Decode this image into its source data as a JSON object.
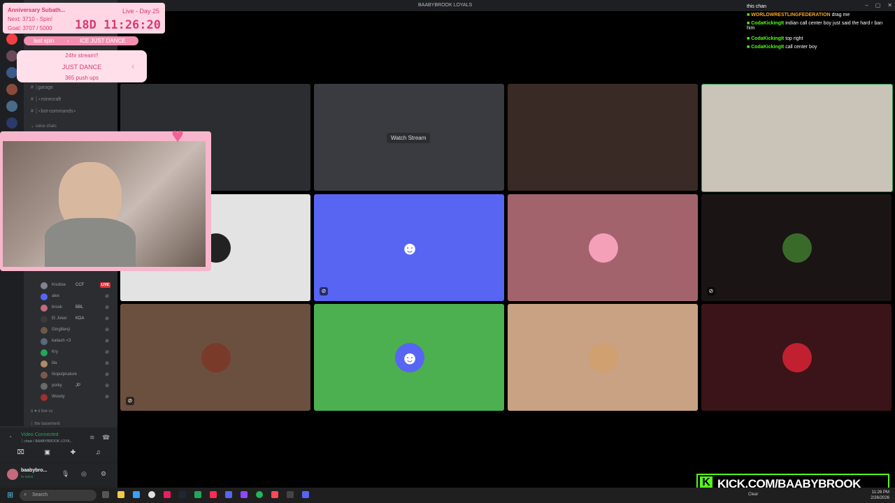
{
  "titlebar": {
    "title": "BAABYBROOK LOYALS",
    "controls": [
      "–",
      "▢",
      "✕"
    ]
  },
  "overlay": {
    "subathon_title": "Anniversary Subath...",
    "day_label": "Live - Day 25",
    "next_label": "Next: 3710 - Spin!",
    "goal_label": "Goal: 3707 / 5000",
    "timer": "18D 11:26:20",
    "last_spin_label": "last spin",
    "last_spin_value": "ICE JUST DANCE",
    "wheel_items": [
      "24hr stream!!",
      "JUST DANCE",
      "365 push ups"
    ]
  },
  "channels": [
    {
      "label": "# ┆garage"
    },
    {
      "label": "# ┆⋆minecraft"
    },
    {
      "label": "# ┆⋆bot-commands⋆"
    },
    {
      "label": "⌄ voice chats"
    }
  ],
  "members": [
    {
      "name": "Knotise",
      "tag": "CCF",
      "badge": "LIVE",
      "color": "#80848e"
    },
    {
      "name": "alex",
      "tag": "",
      "badge": "",
      "color": "#5865f2"
    },
    {
      "name": "brook",
      "tag": "BBL",
      "badge": "",
      "color": "#c46a7a"
    },
    {
      "name": "El Joker",
      "tag": "KDA",
      "badge": "",
      "color": "#3a3a3a"
    },
    {
      "name": "Gingillenji",
      "tag": "",
      "badge": "",
      "color": "#6b5a4a"
    },
    {
      "name": "kailash <3",
      "tag": "",
      "badge": "",
      "color": "#5a6a7a"
    },
    {
      "name": "Kry",
      "tag": "",
      "badge": "",
      "color": "#23a55a"
    },
    {
      "name": "lila",
      "tag": "",
      "badge": "",
      "color": "#b08a6a"
    },
    {
      "name": "Nopulpnature",
      "tag": "",
      "badge": "",
      "color": "#7a5a4a"
    },
    {
      "name": "porky",
      "tag": "JP",
      "badge": "",
      "color": "#6a6a6a"
    },
    {
      "name": "Woody",
      "tag": "",
      "badge": "",
      "color": "#a03030"
    }
  ],
  "voice_channels": [
    "o ♥ ♯ live vc",
    "┆ the basement"
  ],
  "voice_panel": {
    "status": "Video Connected",
    "channel": "┆ chats / BAABYBROOK LOYA..."
  },
  "user_panel": {
    "name": "baabybro...",
    "status": "In voice"
  },
  "grid": {
    "watch_stream": "Watch Stream",
    "tile_colors": [
      "#2b2d31",
      "#3a3b40",
      "#3a2a26",
      "#c9c3b8",
      "#e3e3e3",
      "#5865f2",
      "#a3636c",
      "#1a1414",
      "#6b5040",
      "#4caf50",
      "#c8a282",
      "#3a1418"
    ]
  },
  "chat": [
    {
      "user": "",
      "text": "this chan",
      "color": "#ffffff"
    },
    {
      "user": "WORLDWRESTLINGFEDERATION",
      "text": "drag me",
      "color": "#f5a623"
    },
    {
      "user": "CodaKickingIt",
      "text": "indian call center boy just said the hard r ban him",
      "color": "#53fc18"
    },
    {
      "user": "CodaKickingIt",
      "text": "top right",
      "color": "#53fc18"
    },
    {
      "user": "CodaKickingIt",
      "text": "call center boy",
      "color": "#53fc18"
    }
  ],
  "kick_banner": "KICK.COM/BAABYBROOK",
  "taskbar": {
    "search_placeholder": "Search",
    "time": "11:26 PM",
    "date": "2/26/2026",
    "weather": "Clear"
  }
}
